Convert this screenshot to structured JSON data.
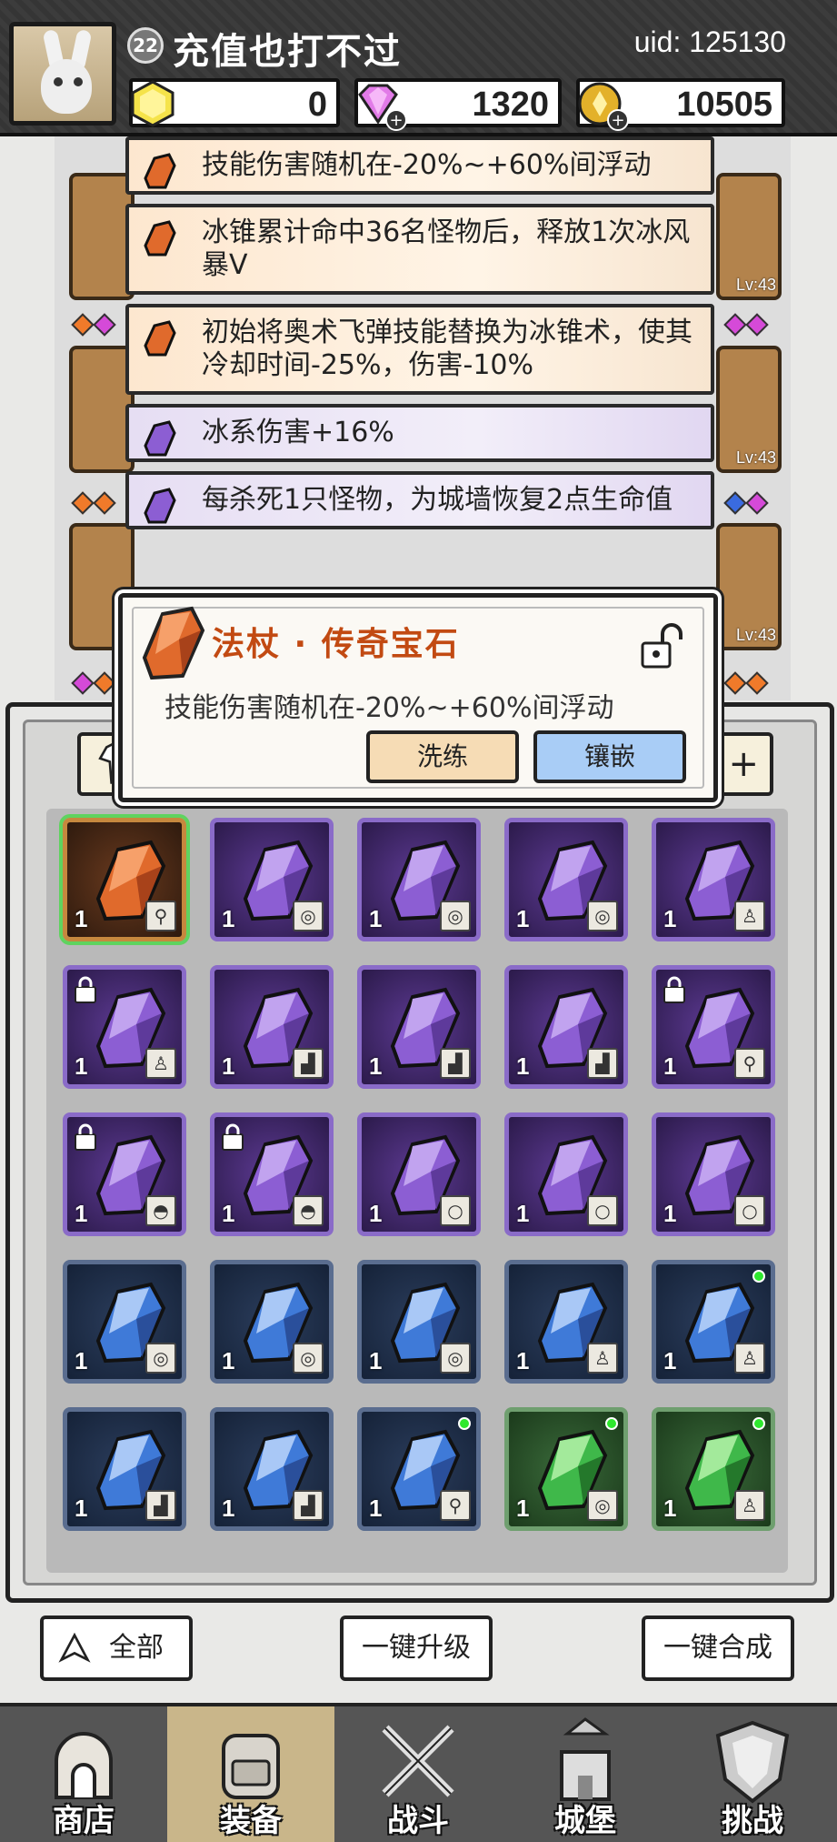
{
  "header": {
    "avatar_name": "avatar",
    "level": "22",
    "player_name": "充值也打不过",
    "uid": "uid: 125130",
    "resources": [
      {
        "icon": "yellow-hexagon-gem-icon",
        "value": "0"
      },
      {
        "icon": "pink-diamond-icon",
        "value": "1320",
        "has_plus": true
      },
      {
        "icon": "gold-coin-icon",
        "value": "10505",
        "has_plus": true
      }
    ]
  },
  "equip_slots": {
    "levels": [
      "Lv:43",
      "Lv:43",
      "Lv:43"
    ]
  },
  "affixes": [
    {
      "color": "orange",
      "text": "技能伤害随机在-20%~+60%间浮动"
    },
    {
      "color": "orange",
      "text": "冰锥累计命中36名怪物后，释放1次冰风暴V"
    },
    {
      "color": "orange",
      "text": "初始将奥术飞弹技能替换为冰锥术，使其冷却时间-25%，伤害-10%"
    },
    {
      "color": "purple",
      "text": "冰系伤害+16%"
    },
    {
      "color": "purple",
      "text": "每杀死1只怪物，为城墙恢复2点生命值"
    }
  ],
  "popup": {
    "title": "法杖 · 传奇宝石",
    "description": "技能伤害随机在-20%~+60%间浮动",
    "refine_label": "洗练",
    "inlay_label": "镶嵌"
  },
  "inventory": {
    "items": [
      {
        "color": "orange",
        "qty": "1",
        "slot": "staff",
        "locked": false,
        "new": false,
        "selected": true
      },
      {
        "color": "purple",
        "qty": "1",
        "slot": "ring",
        "locked": false,
        "new": false
      },
      {
        "color": "purple",
        "qty": "1",
        "slot": "ring",
        "locked": false,
        "new": false
      },
      {
        "color": "purple",
        "qty": "1",
        "slot": "ring",
        "locked": false,
        "new": false
      },
      {
        "color": "purple",
        "qty": "1",
        "slot": "armor",
        "locked": false,
        "new": false
      },
      {
        "color": "purple",
        "qty": "1",
        "slot": "armor",
        "locked": true,
        "new": false
      },
      {
        "color": "purple",
        "qty": "1",
        "slot": "boots",
        "locked": false,
        "new": false
      },
      {
        "color": "purple",
        "qty": "1",
        "slot": "boots",
        "locked": false,
        "new": false
      },
      {
        "color": "purple",
        "qty": "1",
        "slot": "boots",
        "locked": false,
        "new": false
      },
      {
        "color": "purple",
        "qty": "1",
        "slot": "staff",
        "locked": true,
        "new": false
      },
      {
        "color": "purple",
        "qty": "1",
        "slot": "hat",
        "locked": true,
        "new": false
      },
      {
        "color": "purple",
        "qty": "1",
        "slot": "hat",
        "locked": true,
        "new": false
      },
      {
        "color": "purple",
        "qty": "1",
        "slot": "necklace",
        "locked": false,
        "new": false
      },
      {
        "color": "purple",
        "qty": "1",
        "slot": "necklace",
        "locked": false,
        "new": false
      },
      {
        "color": "purple",
        "qty": "1",
        "slot": "necklace",
        "locked": false,
        "new": false
      },
      {
        "color": "blue",
        "qty": "1",
        "slot": "ring",
        "locked": false,
        "new": false
      },
      {
        "color": "blue",
        "qty": "1",
        "slot": "ring",
        "locked": false,
        "new": false
      },
      {
        "color": "blue",
        "qty": "1",
        "slot": "ring",
        "locked": false,
        "new": false
      },
      {
        "color": "blue",
        "qty": "1",
        "slot": "armor",
        "locked": false,
        "new": false
      },
      {
        "color": "blue",
        "qty": "1",
        "slot": "armor",
        "locked": false,
        "new": true
      },
      {
        "color": "blue",
        "qty": "1",
        "slot": "boots",
        "locked": false,
        "new": false
      },
      {
        "color": "blue",
        "qty": "1",
        "slot": "boots",
        "locked": false,
        "new": false
      },
      {
        "color": "blue",
        "qty": "1",
        "slot": "staff",
        "locked": false,
        "new": true
      },
      {
        "color": "green",
        "qty": "1",
        "slot": "ring",
        "locked": false,
        "new": true
      },
      {
        "color": "green",
        "qty": "1",
        "slot": "armor",
        "locked": false,
        "new": true
      }
    ]
  },
  "actions": {
    "filter_label": "全部",
    "upgrade_all_label": "一键升级",
    "merge_all_label": "一键合成"
  },
  "nav": [
    {
      "label": "商店",
      "icon": "shop-icon",
      "active": false
    },
    {
      "label": "装备",
      "icon": "backpack-icon",
      "active": true
    },
    {
      "label": "战斗",
      "icon": "crossed-swords-icon",
      "active": false
    },
    {
      "label": "城堡",
      "icon": "castle-icon",
      "active": false
    },
    {
      "label": "挑战",
      "icon": "shield-icon",
      "active": false
    }
  ],
  "colors": {
    "orange_gem": "#e06a2c",
    "purple_gem": "#8c5ed3",
    "blue_gem": "#3f7ad8",
    "green_gem": "#3fb84a",
    "popup_title": "#c24a12"
  }
}
